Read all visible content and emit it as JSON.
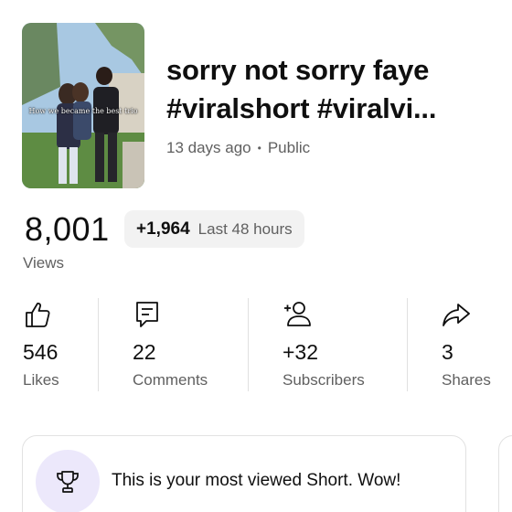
{
  "video": {
    "thumbnail_caption": "How we became the best trio",
    "title": "sorry not sorry faye #viralshort #viralvi...",
    "age": "13 days ago",
    "separator": "•",
    "visibility": "Public"
  },
  "views": {
    "count": "8,001",
    "label": "Views",
    "delta_value": "+1,964",
    "delta_label": "Last 48 hours"
  },
  "metrics": [
    {
      "icon": "thumbs-up-icon",
      "value": "546",
      "label": "Likes"
    },
    {
      "icon": "comment-icon",
      "value": "22",
      "label": "Comments"
    },
    {
      "icon": "add-person-icon",
      "value": "+32",
      "label": "Subscribers"
    },
    {
      "icon": "share-icon",
      "value": "3",
      "label": "Shares"
    }
  ],
  "milestone": {
    "icon": "trophy-icon",
    "text": "This is your most viewed Short. Wow!"
  },
  "colors": {
    "primary_text": "#0f0f0f",
    "secondary_text": "#606060",
    "pill_background": "#f2f2f2",
    "trophy_circle": "#ece8fb"
  }
}
